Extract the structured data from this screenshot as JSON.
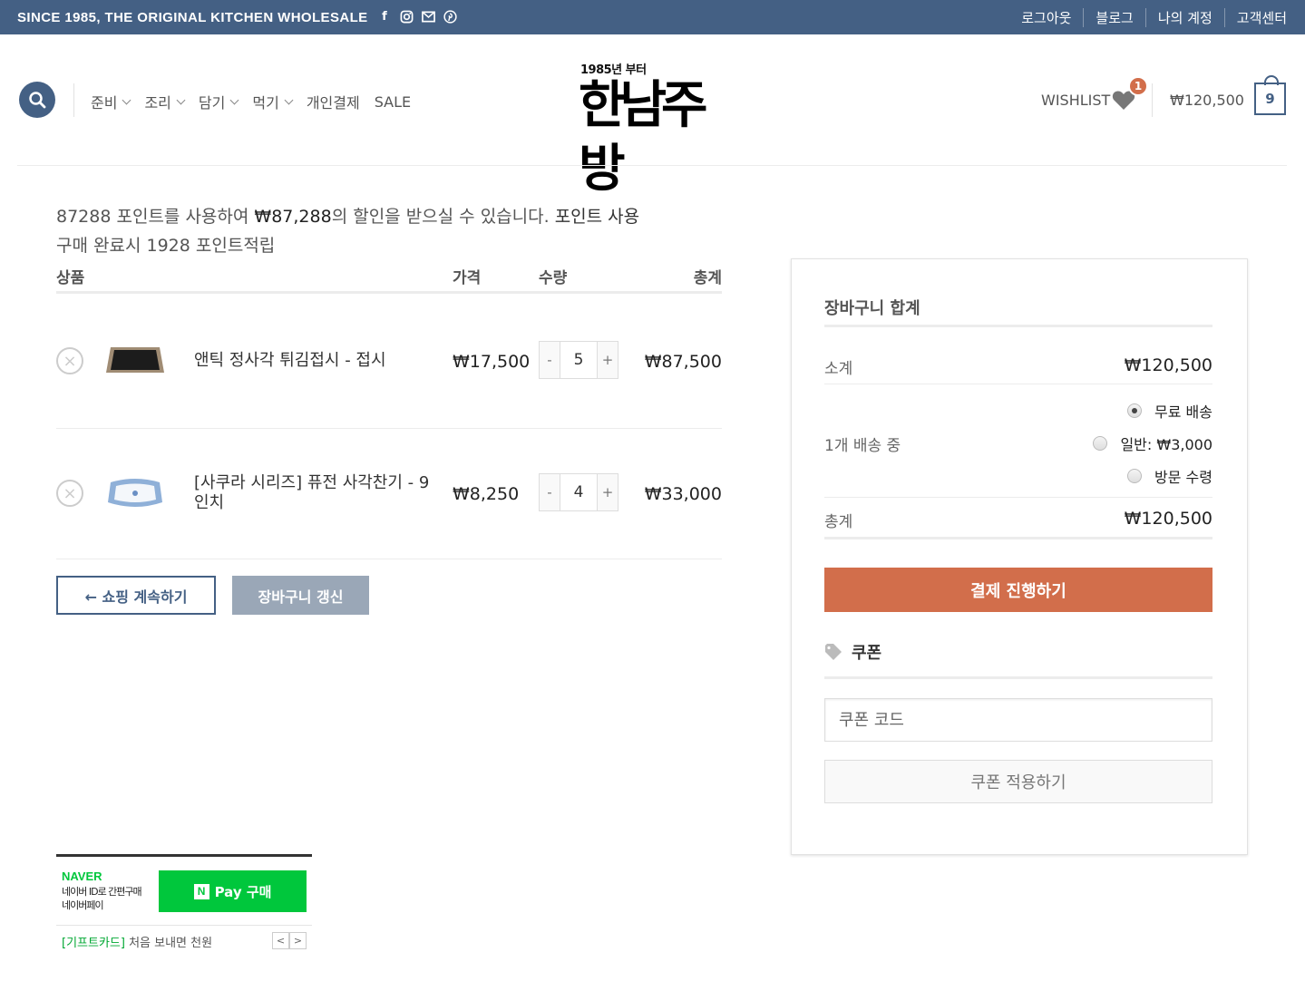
{
  "topbar": {
    "tagline": "SINCE 1985, THE ORIGINAL KITCHEN WHOLESALE",
    "social_icons": [
      "facebook-icon",
      "instagram-icon",
      "envelope-icon",
      "pinterest-icon"
    ],
    "links": [
      "로그아웃",
      "블로그",
      "나의 계정",
      "고객센터"
    ]
  },
  "header": {
    "nav": [
      "준비",
      "조리",
      "담기",
      "먹기",
      "개인결제",
      "SALE"
    ],
    "logo_since": "1985년 부터",
    "logo_name": "한남주방",
    "wishlist_label": "WISHLIST",
    "wishlist_count": "1",
    "cart_total": "₩120,500",
    "cart_count": "9"
  },
  "notice": {
    "points": "87288",
    "text_a": " 포인트를 사용하여 ",
    "discount": "₩87,288",
    "text_b": "의 할인을 받으실 수 있습니다. ",
    "link": "포인트 사용",
    "earn_a": "구매 완료시 ",
    "earn_points": "1928",
    "earn_b": " 포인트적립"
  },
  "table": {
    "headers": {
      "product": "상품",
      "price": "가격",
      "qty": "수량",
      "total": "총계"
    },
    "rows": [
      {
        "name": "앤틱 정사각 튀김접시 - 접시",
        "price": "₩17,500",
        "qty": "5",
        "subtotal": "₩87,500"
      },
      {
        "name": "[사쿠라 시리즈] 퓨전 사각찬기 - 9 인치",
        "price": "₩8,250",
        "qty": "4",
        "subtotal": "₩33,000"
      }
    ]
  },
  "buttons": {
    "continue": "← 쇼핑 계속하기",
    "update": "장바구니 갱신"
  },
  "totals": {
    "title": "장바구니 합계",
    "subtotal_label": "소계",
    "subtotal_value": "₩120,500",
    "shipping_label": "1개 배송 중",
    "shipping_options": [
      "무료 배송",
      "일반: ₩3,000",
      "방문 수령"
    ],
    "selected_shipping": "무료 배송",
    "total_label": "총계",
    "total_value": "₩120,500",
    "checkout": "결제 진행하기",
    "coupon_title": "쿠폰",
    "coupon_placeholder": "쿠폰 코드",
    "coupon_button": "쿠폰 적용하기"
  },
  "naverpay": {
    "brand": "NAVER",
    "desc_line1": "네이버 ID로 간편구매",
    "desc_line2": "네이버페이",
    "button": "Pay 구매",
    "promo_tag": "[기프트카드]",
    "promo_text": " 처음 보내면 천원"
  },
  "colors": {
    "primary": "#446084",
    "accent": "#d26e4b",
    "naver_green": "#00c73c"
  }
}
